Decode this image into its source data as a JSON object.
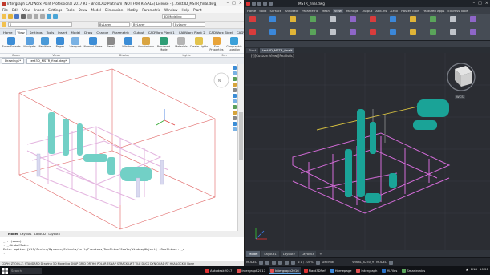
{
  "left_app": {
    "title": "Intergraph CADWorx Plant Professional 2017 R1 - BricsCAD Platinum (NOT FOR RESALE) License - [...test3D_MSTR_final.dwg]",
    "menu": [
      "File",
      "Edit",
      "View",
      "Insert",
      "Settings",
      "Tools",
      "Draw",
      "Model",
      "Dimension",
      "Modify",
      "Parametric",
      "Window",
      "Help",
      "Plant"
    ],
    "toolbar": {
      "workspace_select": "3D Modeling",
      "layer_select": "0",
      "color_select": "ByLayer",
      "linetype_select": "ByLayer",
      "lineweight_select": "ByLayer"
    },
    "ribbon_tabs": [
      "Home",
      "View",
      "Settings",
      "Tools",
      "Insert",
      "Model",
      "Draw",
      "Change",
      "Parametric",
      "Output",
      "CADWorx Plant 1",
      "CADWorx Plant 2",
      "CADWorx Steel",
      "CADWorx HVAC"
    ],
    "active_ribbon_tab": "View",
    "ribbon_buttons": [
      {
        "label": "Zoom Extents",
        "icon": "zoom-extents-icon"
      },
      {
        "label": "Navigate",
        "icon": "navigate-icon"
      },
      {
        "label": "Realtime",
        "icon": "realtime-icon"
      },
      {
        "label": "Regen",
        "icon": "regen-icon"
      },
      {
        "label": "Viewport",
        "icon": "viewport-icon"
      },
      {
        "label": "Named Views",
        "icon": "named-views-icon"
      },
      {
        "label": "Panel",
        "icon": "panel-icon"
      },
      {
        "label": "Windows",
        "icon": "windows-icon"
      },
      {
        "label": "Annotations",
        "icon": "annotations-icon"
      },
      {
        "label": "Rendered Mode",
        "icon": "render-mode-icon"
      },
      {
        "label": "Materials",
        "icon": "materials-icon"
      },
      {
        "label": "Create Lights",
        "icon": "lights-icon"
      },
      {
        "label": "Sun Properties",
        "icon": "sun-icon"
      },
      {
        "label": "Geographic Location",
        "icon": "geo-location-icon"
      }
    ],
    "ribbon_groups": [
      "Zoom",
      "Views",
      "Display",
      "Lights",
      "Sun"
    ],
    "doc_tabs": [
      "Drawing1*",
      "test3D_MSTR_final.dwg*"
    ],
    "layout_tabs": [
      "Model",
      "Layout1",
      "Layout2",
      "Layout3"
    ],
    "command_lines": [
      "_ : (zoom)",
      ": _<Undo/Mode>",
      "Enter option [All/Center/Dynamic/Extents/Left/Previous/Realtime/Scale/Window/Object] <Realtime>: _e",
      ": "
    ],
    "statusbar": "CDPH, ZTOOL.Z, STANDARD  Drawing  3D Modeling  SNAP  GRID  ORTHO  POLAR  ESNAP  STRACK  LWT  TILE  DUCS  DYN  QUAD  RT  HKA  LOCKUI  None"
  },
  "right_app": {
    "title": "MSTR_final.dwg",
    "ribbon_tabs": [
      "Home",
      "Solid",
      "Surface",
      "Annotate",
      "Parametric",
      "Mesh",
      "View",
      "Manage",
      "Output",
      "Add-ins",
      "A360",
      "Raster Tools",
      "Featured Apps",
      "Express Tools"
    ],
    "ribbon_group_labels": [
      "Sheet Set Types",
      "Palettes",
      "Interface",
      "ORTHOGRAPHIC",
      "Layers"
    ],
    "doc_tabs": [
      "Start",
      "test3D_MSTR_final*"
    ],
    "viewport_label": "[-][Custom View][Realistic]",
    "viewcube_label": "WCS",
    "layout_tabs": [
      "Model",
      "Layout1",
      "Layout2",
      "Layout3"
    ],
    "statusbar": [
      "MODEL",
      "1:1 / 100%",
      "Decimal",
      "WIN8L_X250_9",
      "MODEL"
    ]
  },
  "taskbar": {
    "search_placeholder": "Search",
    "tasks": [
      {
        "label": "Autodesk2017",
        "active": false
      },
      {
        "label": "Intergraph2017",
        "active": false
      },
      {
        "label": "Intergraph2016",
        "active": true
      },
      {
        "label": "Plant3DRef",
        "active": false
      },
      {
        "label": "Homepage",
        "active": false
      },
      {
        "label": "Intergraph",
        "active": false
      },
      {
        "label": "M-Files",
        "active": false
      },
      {
        "label": "Smartronics",
        "active": false
      }
    ],
    "tray_lang": "ENG",
    "clock": "10:28"
  },
  "colors": {
    "left_cad_box": "#e06565",
    "left_pipe": "#e3b4df",
    "left_vessel": "#72d0c6",
    "right_vessel": "#1aa397",
    "right_pipe": "#d36bd8",
    "right_line_yellow": "#d6c040",
    "taskbar_bg": "#101216"
  }
}
